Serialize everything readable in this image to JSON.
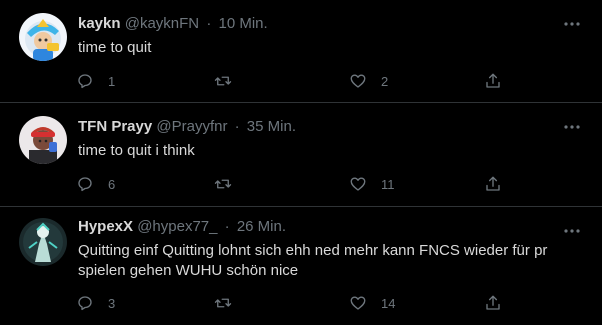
{
  "tweets": [
    {
      "name": "kaykn",
      "handle": "@kayknFN",
      "separator": "·",
      "time": "10 Min.",
      "text": "time to quit",
      "replies": "1",
      "retweets": "",
      "likes": "2",
      "avatar_icon": "avatar-cartoon-character"
    },
    {
      "name": "TFN Prayy",
      "handle": "@Prayyfnr",
      "separator": "·",
      "time": "35 Min.",
      "text": "time to quit i think",
      "replies": "6",
      "retweets": "",
      "likes": "11",
      "avatar_icon": "avatar-person-cap"
    },
    {
      "name": "HypexX",
      "handle": "@hypex77_",
      "separator": "·",
      "time": "26 Min.",
      "text": "Quitting einf Quitting lohnt sich ehh ned mehr kann FNCS wieder für pr spielen gehen WUHU schön nice",
      "replies": "3",
      "retweets": "",
      "likes": "14",
      "avatar_icon": "avatar-game-character"
    }
  ],
  "icons": {
    "more": "more-dots-icon",
    "reply": "reply-icon",
    "retweet": "retweet-icon",
    "like": "heart-icon",
    "share": "share-icon"
  },
  "colors": {
    "background": "#000000",
    "text": "#d9d9d9",
    "secondary": "#6e767d",
    "divider": "#2f3336"
  }
}
